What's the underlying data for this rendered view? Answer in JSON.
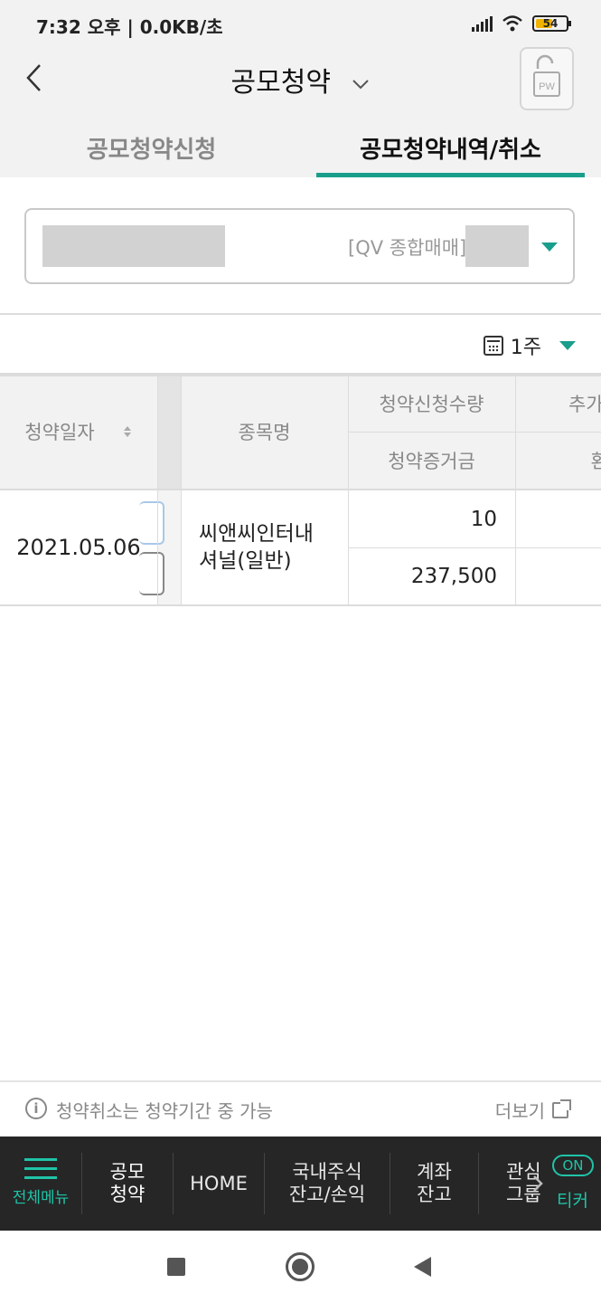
{
  "status_bar": {
    "time": "7:32 오후",
    "net": " | 0.0KB/초",
    "battery": "54"
  },
  "header": {
    "title": "공모청약",
    "pw_label": "PW"
  },
  "tabs": [
    {
      "label": "공모청약신청",
      "active": false
    },
    {
      "label": "공모청약내역/취소",
      "active": true
    }
  ],
  "account": {
    "type_label": "[QV 종합매매]"
  },
  "filter": {
    "period": "1주"
  },
  "table": {
    "headers": {
      "date": "청약일자",
      "name": "종목명",
      "qty": "청약신청수량",
      "deposit": "청약증거금",
      "extra_top": "추가납",
      "extra_bottom": "환"
    },
    "rows": [
      {
        "date": "2021.05.06",
        "name_line1": "씨앤씨인터내",
        "name_line2": "셔널(일반)",
        "qty": "10",
        "deposit": "237,500"
      }
    ]
  },
  "footer": {
    "notice": "청약취소는 청약기간 중 가능",
    "more": "더보기"
  },
  "nav": {
    "menu": "전체메뉴",
    "item1_l1": "공모",
    "item1_l2": "청약",
    "item2": "HOME",
    "item3_l1": "국내주식",
    "item3_l2": "잔고/손익",
    "item4_l1": "계좌",
    "item4_l2": "잔고",
    "item5_l1": "관심",
    "item5_l2": "그룹",
    "on_badge": "ON",
    "ticker": "티커"
  },
  "colors": {
    "accent": "#1a9e8c",
    "nav_bg": "#262626",
    "nav_accent": "#1fc4a8"
  }
}
